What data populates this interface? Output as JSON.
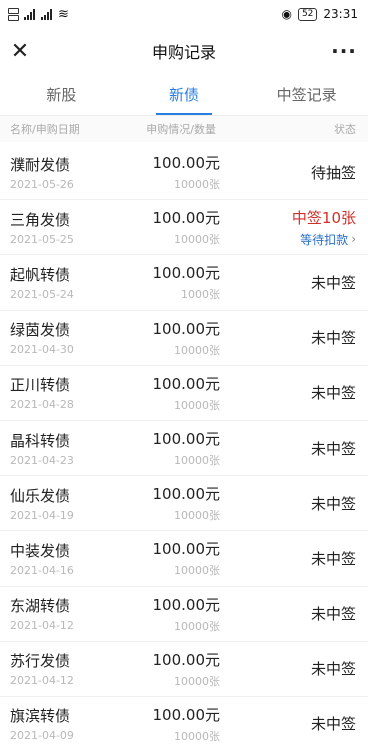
{
  "status_bar": {
    "time": "23:31",
    "battery": "52",
    "network_a": "4G",
    "network_b": "4G"
  },
  "navbar": {
    "title": "申购记录",
    "close_icon": "close-icon",
    "more_icon": "more-icon"
  },
  "tabs": [
    {
      "label": "新股",
      "active": false
    },
    {
      "label": "新债",
      "active": true
    },
    {
      "label": "中签记录",
      "active": false
    }
  ],
  "columns": {
    "name_date": "名称/申购日期",
    "amount_qty": "申购情况/数量",
    "status": "状态"
  },
  "rows": [
    {
      "name": "濮耐发债",
      "date": "2021-05-26",
      "amount": "100.00元",
      "qty": "10000张",
      "status": "待抽签",
      "sub": ""
    },
    {
      "name": "三角发债",
      "date": "2021-05-25",
      "amount": "100.00元",
      "qty": "10000张",
      "status": "中签10张",
      "sub": "等待扣款"
    },
    {
      "name": "起帆转债",
      "date": "2021-05-24",
      "amount": "100.00元",
      "qty": "1000张",
      "status": "未中签",
      "sub": ""
    },
    {
      "name": "绿茵发债",
      "date": "2021-04-30",
      "amount": "100.00元",
      "qty": "10000张",
      "status": "未中签",
      "sub": ""
    },
    {
      "name": "正川转债",
      "date": "2021-04-28",
      "amount": "100.00元",
      "qty": "10000张",
      "status": "未中签",
      "sub": ""
    },
    {
      "name": "晶科转债",
      "date": "2021-04-23",
      "amount": "100.00元",
      "qty": "10000张",
      "status": "未中签",
      "sub": ""
    },
    {
      "name": "仙乐发债",
      "date": "2021-04-19",
      "amount": "100.00元",
      "qty": "10000张",
      "status": "未中签",
      "sub": ""
    },
    {
      "name": "中装发债",
      "date": "2021-04-16",
      "amount": "100.00元",
      "qty": "10000张",
      "status": "未中签",
      "sub": ""
    },
    {
      "name": "东湖转债",
      "date": "2021-04-12",
      "amount": "100.00元",
      "qty": "10000张",
      "status": "未中签",
      "sub": ""
    },
    {
      "name": "苏行发债",
      "date": "2021-04-12",
      "amount": "100.00元",
      "qty": "10000张",
      "status": "未中签",
      "sub": ""
    },
    {
      "name": "旗滨转债",
      "date": "2021-04-09",
      "amount": "100.00元",
      "qty": "10000张",
      "status": "未中签",
      "sub": ""
    }
  ],
  "colors": {
    "accent": "#2a7de1",
    "win": "#d0302b",
    "link": "#2a6ec4"
  }
}
